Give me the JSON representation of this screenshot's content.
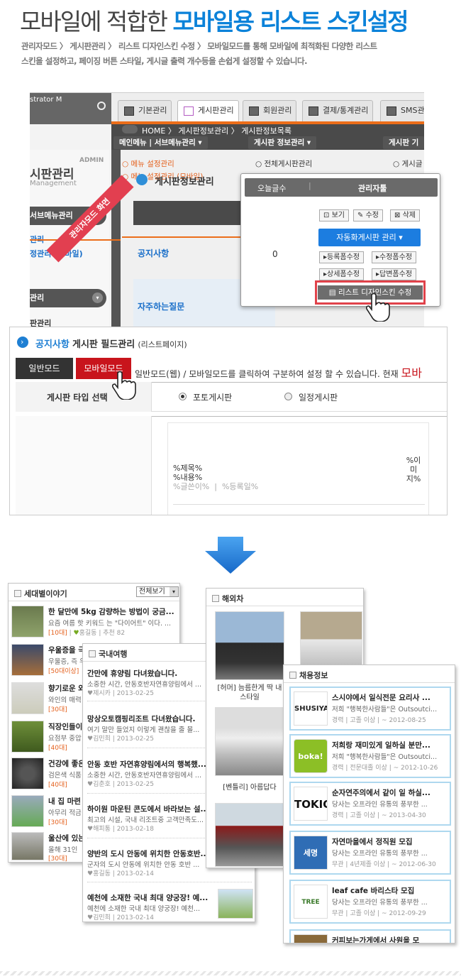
{
  "header": {
    "title_plain": "모바일에 적합한",
    "title_bold": "모바일용 리스트 스킨설정",
    "breadcrumb": "관리자모드 〉 게시판관리 〉 리스트 디자인스킨 수정 〉",
    "desc_line1": "모바일모드를 통해 모바일에 최적화된 다양한 리스트",
    "desc_line2": "스킨을 설정하고, 페이징 버튼 스타일, 게시글 출력 개수등을 손쉽게 설정할 수 있습니다."
  },
  "admin": {
    "logo_text": "strator M",
    "ribbon": "관리자모드 화면",
    "admin_tag": "ADMIN",
    "side_title": "시판관리",
    "side_sub": "Management",
    "side_menu1": "서브메뉴관리",
    "side_link1": "관리",
    "side_link2": "정관리 (모바일)",
    "side_menu2": "관리",
    "side_link3": "판관리",
    "tabs": [
      "기본관리",
      "게시판관리",
      "회원관리",
      "결제/통계관리",
      "SMS관"
    ],
    "breadcrumb": "HOME 〉 게시판정보관리 〉 게시판정보목록",
    "dropmenus": [
      "메인메뉴 | 서브메뉴관리",
      "게시판 정보관리",
      "게시판 기"
    ],
    "submenu": [
      "메뉴 설정관리",
      "메뉴 설정관리 (모바일)",
      "전체게시판관리",
      "게시글"
    ],
    "section_title": "게시판정보관리",
    "section_btn": "게시",
    "rows": [
      "공지사항",
      "자주하는질문"
    ]
  },
  "popup": {
    "col1": "오늘글수",
    "col2": "관리자툴",
    "count": "0",
    "btn_view": "보기",
    "btn_edit": "수정",
    "btn_delete": "삭제",
    "btn_auto": "자동화게시판 관리",
    "btn_reg": "등록폼수정",
    "btn_modify": "수정폼수정",
    "btn_detail": "상세폼수정",
    "btn_reply": "답변폼수정",
    "btn_list_skin": "리스트 디자인스킨 수정"
  },
  "fieldpanel": {
    "title_blue": "공지사항",
    "title": "게시판 필드관리",
    "title_sub": "(리스트페이지)",
    "tab_normal": "일반모드",
    "tab_mobile": "모바일모드",
    "hint": "일반모드(웹) / 모바일모드를 클릭하여 구분하여 설정 할 수 있습니다. 현재",
    "hint_red": "모바",
    "type_label": "게시판 타입 선택",
    "opt1": "포토게시판",
    "opt2": "일정게시판",
    "tpl_title": "%제목%",
    "tpl_content": "%내용%",
    "tpl_meta": "%글쓴이%  |  %등록일%",
    "tpl_image": "%이미지%"
  },
  "card_generation": {
    "title": "세대별이야기",
    "select": "전체보기",
    "items": [
      {
        "title": "한 달만에 5kg 감량하는 방법이 궁금...",
        "desc": "요즘 여름 핫 키워드 는 \"다이어트\" 이다. ...",
        "tag": "[10대]",
        "author": "홍길동",
        "meta": "추천 82"
      },
      {
        "title": "우울증을 극",
        "desc": "우울증, 즉 우",
        "tag": "[50대이상]",
        "author": "",
        "meta": ""
      },
      {
        "title": "향기로운 와",
        "desc": "와인의 매력",
        "tag": "[30대]",
        "author": "",
        "meta": ""
      },
      {
        "title": "직장인들이",
        "desc": "요점부 중압",
        "tag": "[40대]",
        "author": "",
        "meta": ""
      },
      {
        "title": "건강에 좋은",
        "desc": "검은색 식품",
        "tag": "[40대]",
        "author": "",
        "meta": ""
      },
      {
        "title": "내 집 마련",
        "desc": "아무리 적금",
        "tag": "[30대]",
        "author": "",
        "meta": ""
      },
      {
        "title": "울산에 있는",
        "desc": "올해 31인",
        "tag": "[30대]",
        "author": "",
        "meta": ""
      }
    ]
  },
  "card_travel": {
    "title": "국내여행",
    "items": [
      {
        "title": "간만에 휴양림 다녀왔습니다.",
        "desc": "",
        "author": "제시카",
        "date": "2013-02-25"
      },
      {
        "title": "망상오토캠핑리조트 다녀왔습니다.",
        "desc": "여기 말만 들었지 이렇게 괜찮을 줄 몰...",
        "author": "김민희",
        "date": "2013-02-25"
      },
      {
        "title": "안동 호반 자연휴양림에서의 행복했...",
        "desc": "소중한 시간, 안동호반자연휴양림에서 ...",
        "author": "김춘호",
        "date": "2013-02-25"
      },
      {
        "title": "하이원 마운틴 콘도에서 바라보는 설...",
        "desc": "최고의 시설, 국내 리조트중 고객만족도...",
        "author": "해피통",
        "date": "2013-02-18"
      },
      {
        "title": "양반의 도시 안동에 위치한 안동호반...",
        "desc": "군자의 도시 안동에 위치한 안동 호반 ...",
        "author": "홍길동",
        "date": "2013-02-14"
      },
      {
        "title": "예천에 소재한 국내 최대 양궁장! 예...",
        "desc": "예천에 소재한 국내 최대 양궁장! 예천...",
        "author": "김민희",
        "date": "2013-02-14"
      }
    ],
    "item0_desc": "소중한 시간, 안동호반자연휴양림에서 ..."
  },
  "card_cars": {
    "title": "해외차",
    "items": [
      {
        "caption": "[허머] 늠름한게 딱 내스타일"
      },
      {
        "caption": "[벤틀리] 아름답다"
      }
    ]
  },
  "card_jobs": {
    "title": "채용정보",
    "items": [
      {
        "logo": "SHUSIYA",
        "title": "스시야에서 일식전문 요리사 ...",
        "desc": "저희 \"행복한사람들\"은 Outsoutci...",
        "meta": "경력 | 고졸 이상 | ~ 2012-08-25"
      },
      {
        "logo": "boka! del",
        "title": "저희랑 재미있게 일하실 분만...",
        "desc": "저희 \"행복한사람들\"은 Outsoutci...",
        "meta": "경력 | 전문대졸 이상 | ~ 2012-10-26"
      },
      {
        "logo": "TOKIO",
        "title": "순자연주의에서 같이 일 하실...",
        "desc": "당사는 오프라인 유통의 풍부한 ...",
        "meta": "경력 | 고졸 이상 | ~ 2013-04-30"
      },
      {
        "logo": "세명",
        "title": "자연마을에서 정직원 모집",
        "desc": "당사는 오프라인 유통의 풍부한 ...",
        "meta": "무관 | 4년제졸 이상 | ~ 2012-06-30"
      },
      {
        "logo": "TREE",
        "title": "leaf cafe 바리스타 모집",
        "desc": "당사는 오프라인 유통의 풍부한 ...",
        "meta": "무관 | 고졸 이상 | ~ 2012-09-29"
      },
      {
        "logo": "",
        "title": "커피보는가게에서 사원을 모",
        "desc": "",
        "meta": ""
      }
    ]
  },
  "colors": {
    "accent": "#0b82d9",
    "red": "#c8141c",
    "orange": "#e4601c"
  }
}
